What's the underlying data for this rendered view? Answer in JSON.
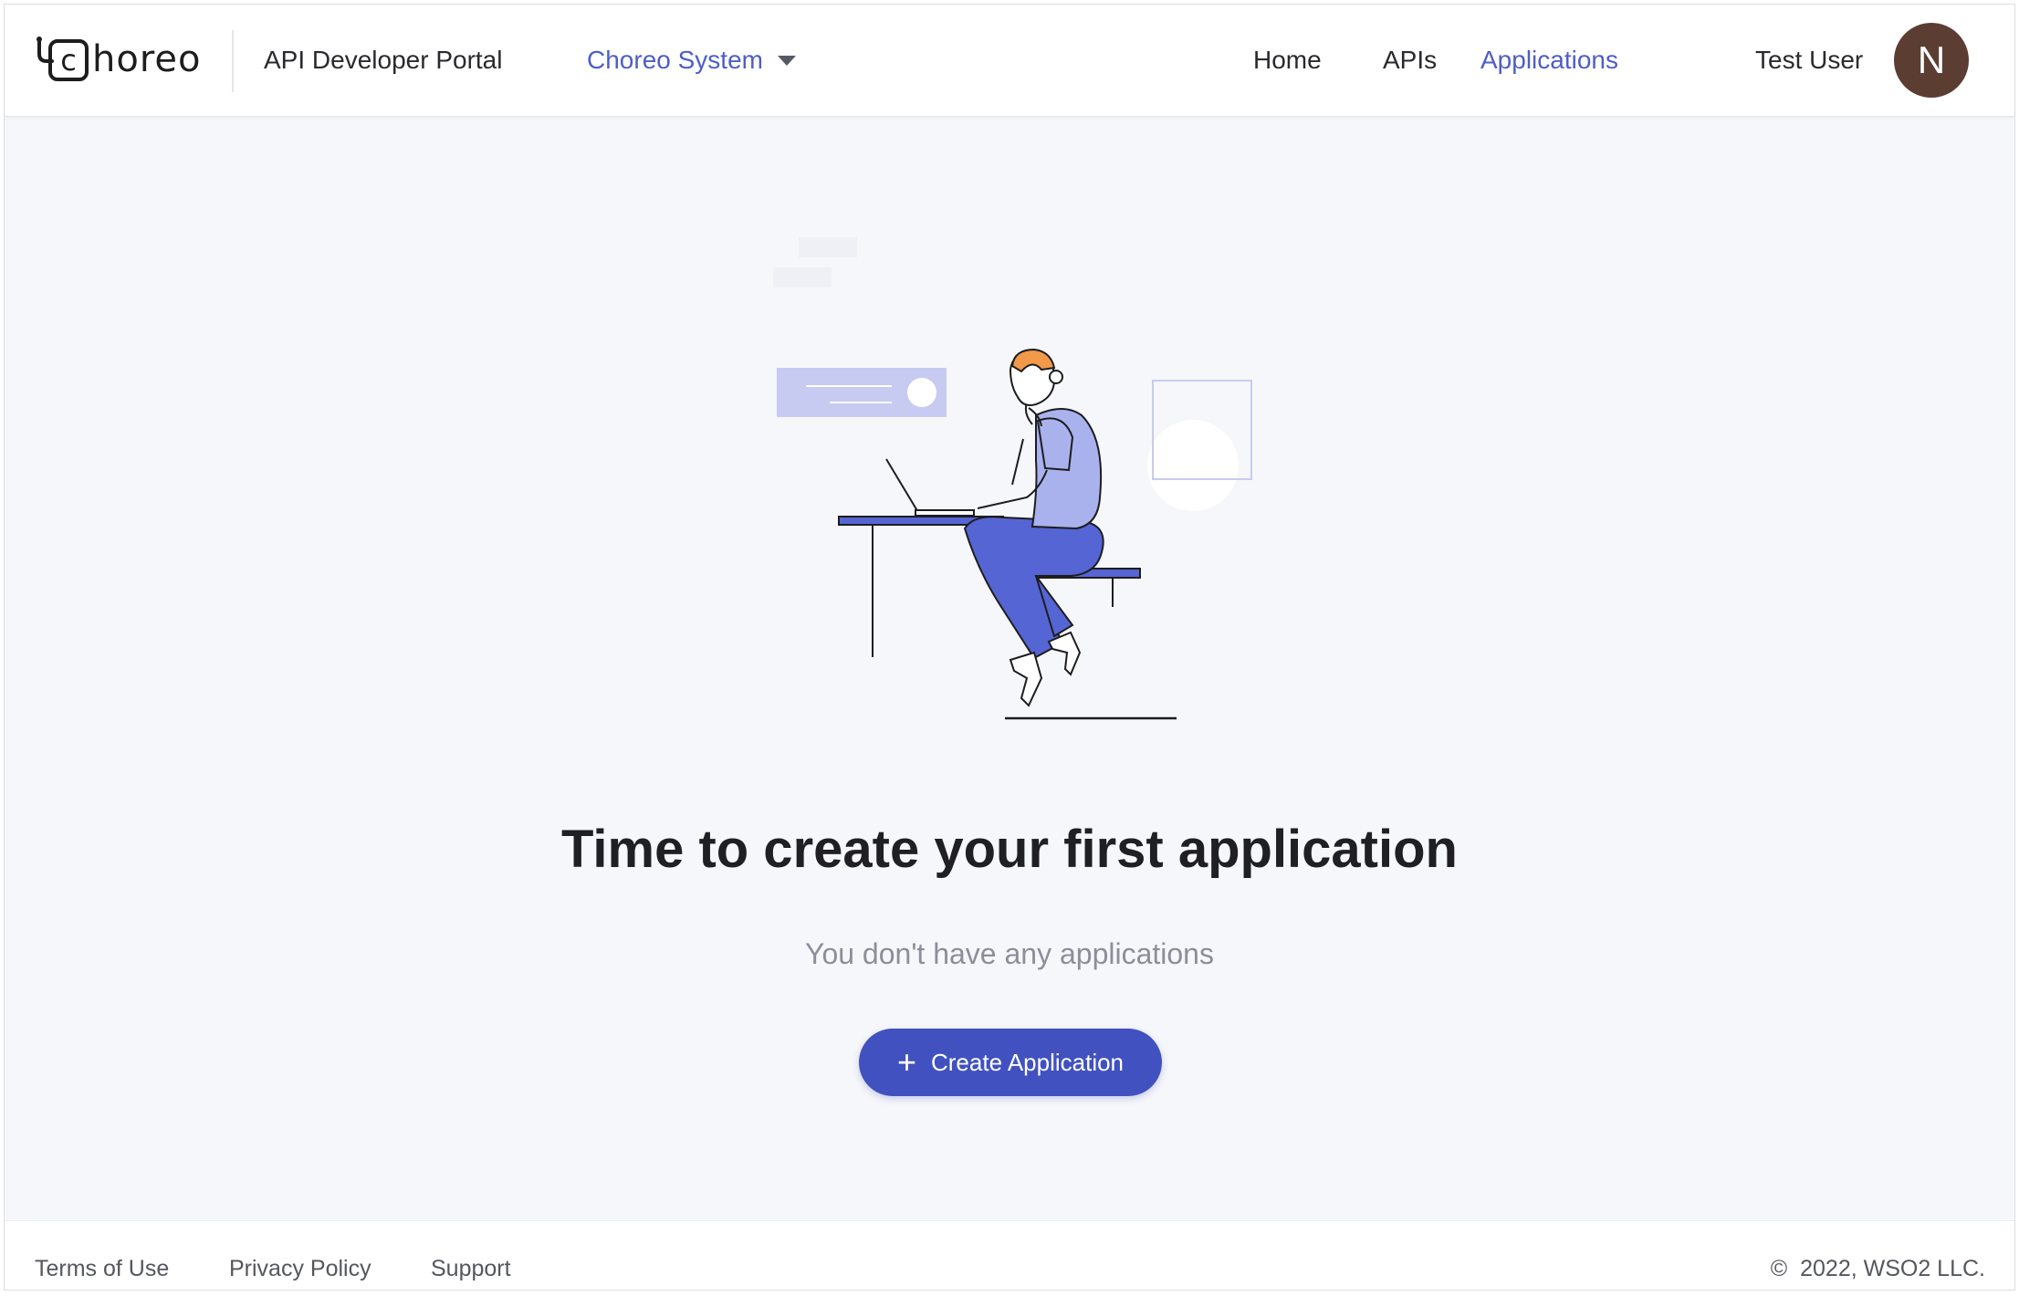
{
  "header": {
    "logo_text": "horeo",
    "logo_mark_letter": "c",
    "portal_title": "API Developer Portal",
    "org_selector": {
      "value": "Choreo System"
    },
    "nav": [
      {
        "label": "Home",
        "active": false
      },
      {
        "label": "APIs",
        "active": false
      },
      {
        "label": "Applications",
        "active": true
      }
    ],
    "user": {
      "name": "Test User",
      "avatar_initial": "N",
      "avatar_color": "#5b3d32"
    }
  },
  "main": {
    "illustration": "person-at-laptop-illustration",
    "headline": "Time to create your first application",
    "subline": "You don't have any applications",
    "create_button": {
      "icon": "plus-icon",
      "label": "Create Application"
    }
  },
  "footer": {
    "links": [
      "Terms of Use",
      "Privacy Policy",
      "Support"
    ],
    "copyright_symbol": "©",
    "copyright": "2022, WSO2 LLC."
  },
  "colors": {
    "accent": "#4d5ec9",
    "button": "#4151c0",
    "background": "#f6f7fa",
    "illustration_blue": "#5565d4",
    "illustration_light_blue": "#aab2ee",
    "hair": "#f2994a"
  }
}
